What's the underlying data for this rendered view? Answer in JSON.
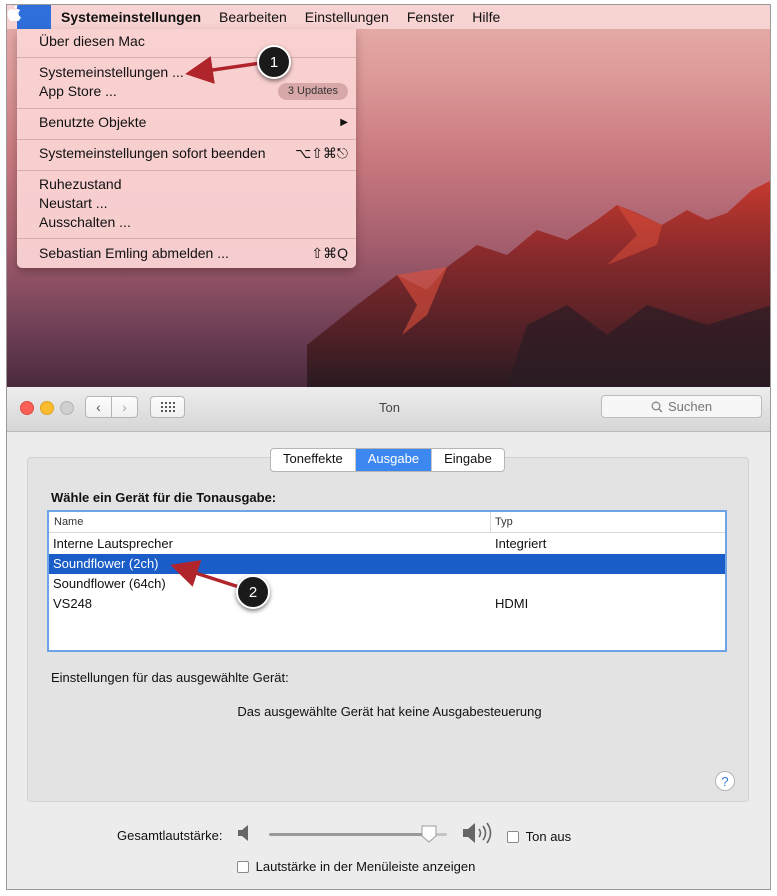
{
  "menubar": {
    "app_name": "Systemeinstellungen",
    "items": [
      "Bearbeiten",
      "Einstellungen",
      "Fenster",
      "Hilfe"
    ]
  },
  "apple_menu": {
    "about": "Über diesen Mac",
    "system_prefs": "Systemeinstellungen ...",
    "app_store": "App Store ...",
    "updates_badge": "3 Updates",
    "recent_items": "Benutzte Objekte",
    "force_quit": "Systemeinstellungen sofort beenden",
    "force_quit_shortcut": "⌥⇧⌘⎋",
    "sleep": "Ruhezustand",
    "restart": "Neustart ...",
    "shutdown": "Ausschalten ...",
    "logout": "Sebastian Emling abmelden ...",
    "logout_shortcut": "⇧⌘Q"
  },
  "annotations": [
    "1",
    "2"
  ],
  "window": {
    "title": "Ton",
    "search_placeholder": "Suchen",
    "tabs": [
      {
        "label": "Toneffekte",
        "active": false
      },
      {
        "label": "Ausgabe",
        "active": true
      },
      {
        "label": "Eingabe",
        "active": false
      }
    ],
    "device_prompt": "Wähle ein Gerät für die Tonausgabe:",
    "columns": {
      "name": "Name",
      "type": "Typ"
    },
    "devices": [
      {
        "name": "Interne Lautsprecher",
        "type": "Integriert"
      },
      {
        "name": "Soundflower (2ch)",
        "type": ""
      },
      {
        "name": "Soundflower (64ch)",
        "type": ""
      },
      {
        "name": "VS248",
        "type": "HDMI"
      }
    ],
    "selected_device": "Soundflower (2ch)",
    "settings_label": "Einstellungen für das ausgewählte Gerät:",
    "no_controls_msg": "Das ausgewählte Gerät hat keine Ausgabesteuerung",
    "help_label": "?",
    "volume_label": "Gesamtlautstärke:",
    "volume_level": 0.9,
    "mute_label": "Ton aus",
    "menubar_volume_label": "Lautstärke in der Menüleiste anzeigen"
  },
  "colors": {
    "accent": "#3d88f0",
    "selection": "#1a5cc8",
    "annotation_arrow": "#b0242c"
  }
}
